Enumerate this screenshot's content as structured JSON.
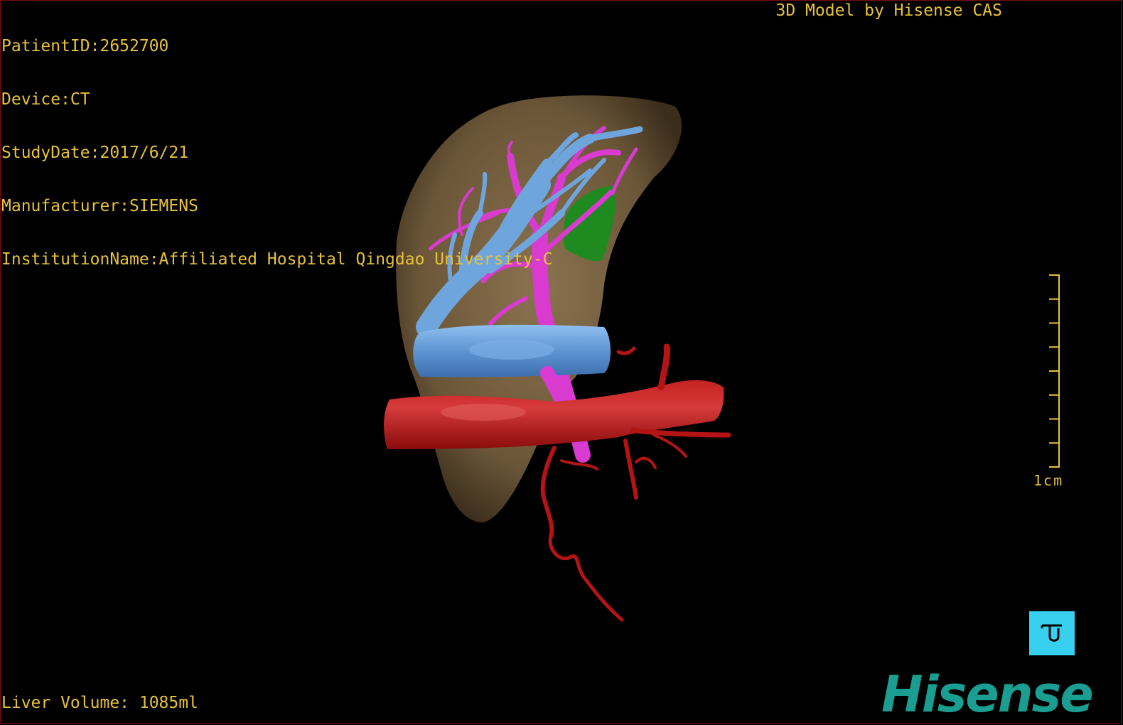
{
  "info": {
    "patient_id": "PatientID:2652700",
    "device": "Device:CT",
    "study_date": "StudyDate:2017/6/21",
    "manufacturer": "Manufacturer:SIEMENS",
    "institution": "InstitutionName:Affiliated Hospital Qingdao University-C"
  },
  "credit": "3D Model by Hisense CAS",
  "liver_volume": "Liver Volume: 1085ml",
  "scale": {
    "label": "1cm",
    "ticks": 9
  },
  "brand": "Hisense",
  "icons": {
    "orientation": "orientation-reset-icon"
  },
  "colors": {
    "overlay_text": "#e8c23a",
    "liver": "#7a6445",
    "portal_vein": "#6fa5dd",
    "hepatic_vein": "#d93ad0",
    "artery": "#b41414",
    "lesion": "#1f8a1f",
    "brand": "#1a9e92",
    "button": "#39d0f0"
  }
}
